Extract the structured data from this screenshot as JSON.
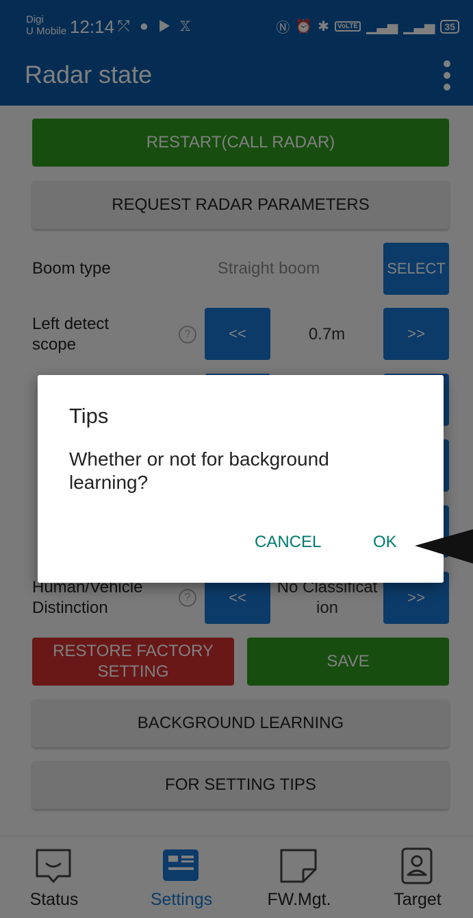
{
  "status_bar": {
    "carrier_line1": "Digi",
    "carrier_line2": "U Mobile",
    "time": "12:14",
    "battery": "35",
    "volte": "VoLTE",
    "left_icons": [
      "missed-call-icon",
      "chat-icon",
      "youtube-icon",
      "x-icon"
    ],
    "right_icons": [
      "nfc-icon",
      "alarm-icon",
      "bluetooth-icon",
      "signal-icon",
      "signal-icon"
    ]
  },
  "app_bar": {
    "title": "Radar state"
  },
  "buttons": {
    "restart": "RESTART(CALL RADAR)",
    "request_params": "REQUEST RADAR PARAMETERS",
    "select": "SELECT",
    "decrease": "<<",
    "increase": ">>",
    "restore": "RESTORE FACTORY SETTING",
    "save": "SAVE",
    "background_learning": "BACKGROUND LEARNING",
    "setting_tips": "FOR SETTING TIPS"
  },
  "settings": {
    "boom_type": {
      "label": "Boom type",
      "value": "Straight boom"
    },
    "left_detect": {
      "label": "Left detect scope",
      "value": "0.7m"
    },
    "human_vehicle": {
      "label": "Human/Vehicle Distinction",
      "value": "No Classification"
    }
  },
  "help_glyph": "?",
  "tabs": [
    {
      "label": "Status",
      "icon": "status-icon",
      "active": false
    },
    {
      "label": "Settings",
      "icon": "settings-icon",
      "active": true
    },
    {
      "label": "FW.Mgt.",
      "icon": "fw-icon",
      "active": false
    },
    {
      "label": "Target",
      "icon": "target-icon",
      "active": false
    }
  ],
  "dialog": {
    "title": "Tips",
    "message": "Whether or not for background learning?",
    "cancel": "CANCEL",
    "ok": "OK"
  },
  "colors": {
    "primary": "#0b5aa6",
    "accent_blue": "#1976d2",
    "green": "#2e9a1e",
    "red": "#d32f2f",
    "dialog_button": "#00796b"
  }
}
